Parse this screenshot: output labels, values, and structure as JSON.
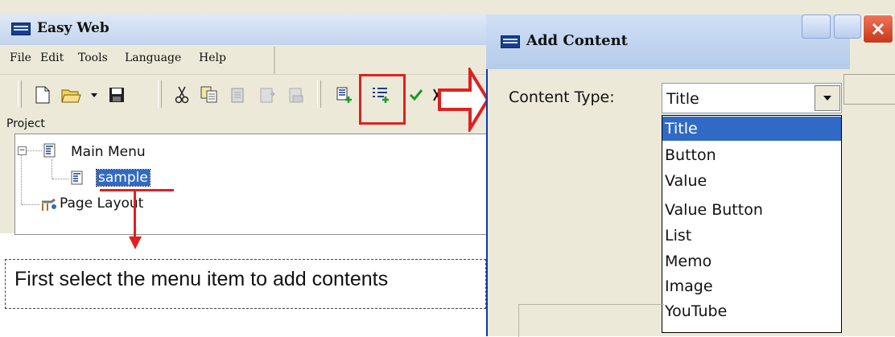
{
  "main_window": {
    "title": "Easy Web",
    "menu": [
      "File",
      "Edit",
      "Tools",
      "Language",
      "Help"
    ],
    "project_label": "Project",
    "tree": {
      "root": "Main Menu",
      "child": "sample",
      "sibling": "Page Layout"
    },
    "toolbar_icons": [
      "new-file-icon",
      "open-folder-icon",
      "dropdown-arrow-icon",
      "save-icon",
      "cut-icon",
      "copy-icon",
      "paste-icon",
      "paste-special-icon",
      "paste-disabled-icon",
      "add-menu-icon",
      "add-content-icon",
      "check-icon",
      "delete-icon"
    ]
  },
  "annotation": {
    "instruction": "First select the menu item to add contents",
    "accent_color": "#e02020"
  },
  "dialog": {
    "title": "Add Content",
    "content_type_label": "Content Type:",
    "selected_value": "Title",
    "options": [
      "Title",
      "Button",
      "Value",
      "Value Button",
      "List",
      "Memo",
      "Image",
      "YouTube"
    ],
    "selection_color": "#316ac5"
  }
}
